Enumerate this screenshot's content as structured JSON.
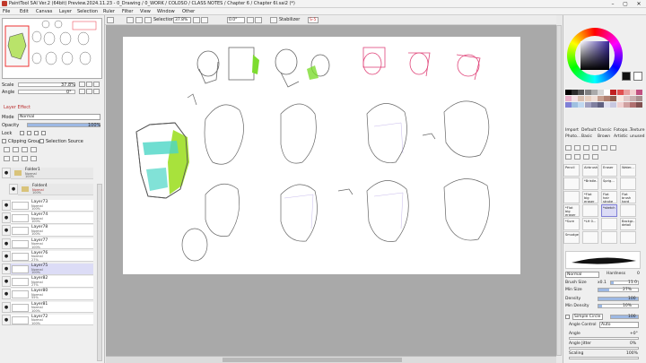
{
  "window": {
    "title": "PaintTool SAI Ver.2 (64bit) Preview.2024.11.23 - 0_Drawing / 0_WORK / COLOSO / CLASS NOTES / Chapter 6 / Chapter 6I.sai2 (*)"
  },
  "menu": [
    "File",
    "Edit",
    "Canvas",
    "Layer",
    "Selection",
    "Ruler",
    "Filter",
    "View",
    "Window",
    "Other"
  ],
  "toolbar": {
    "selection_label": "Selection",
    "zoom": "37.8%",
    "rotation": "0.0°",
    "stabilizer_label": "Stabilizer",
    "stabilizer_value": "S-5"
  },
  "nav": {
    "scale_label": "Scale",
    "scale_value": "37.8%",
    "angle_label": "Angle",
    "angle_value": "0°"
  },
  "layer_effect": {
    "title": "Layer Effect",
    "mode_label": "Mode",
    "mode_value": "Normal",
    "opacity_label": "Opacity",
    "opacity_value": "100%",
    "lock_label": "Lock",
    "clipping_label": "Clipping Group",
    "selection_source_label": "Selection Source"
  },
  "folders": [
    {
      "name": "Folder1",
      "mode": "Normal",
      "opacity": "100%"
    },
    {
      "name": "Folder4",
      "mode": "Normal",
      "opacity": "100%"
    }
  ],
  "layers": [
    {
      "name": "Layer73",
      "mode": "Normal",
      "opacity": "100%",
      "selected": false
    },
    {
      "name": "Layer74",
      "mode": "Normal",
      "opacity": "100%",
      "selected": false
    },
    {
      "name": "Layer78",
      "mode": "Normal",
      "opacity": "100%",
      "selected": false
    },
    {
      "name": "Layer77",
      "mode": "Normal",
      "opacity": "100%",
      "selected": false
    },
    {
      "name": "Layer76",
      "mode": "Normal",
      "opacity": "27%",
      "selected": false
    },
    {
      "name": "Layer75",
      "mode": "Normal",
      "opacity": "100%",
      "selected": true
    },
    {
      "name": "Layer82",
      "mode": "Normal",
      "opacity": "27%",
      "selected": false
    },
    {
      "name": "Layer80",
      "mode": "Normal",
      "opacity": "55%",
      "selected": false
    },
    {
      "name": "Layer81",
      "mode": "Normal",
      "opacity": "100%",
      "selected": false
    },
    {
      "name": "Layer72",
      "mode": "Normal",
      "opacity": "100%",
      "selected": false
    }
  ],
  "tool_tabs": [
    "Import",
    "Default",
    "Classic",
    "Fotopo...",
    "Texture",
    "Photo...",
    "Basic",
    "Brown",
    "Artistic",
    "unused"
  ],
  "brushes": [
    [
      "Pencil",
      "Airbrush",
      "Eraser",
      "Water..."
    ],
    [
      "",
      "*Bristle...",
      "Sprig...",
      ""
    ],
    [
      "",
      "*Flat big eraser",
      "Flat hair stroke",
      "Flat brush hard"
    ],
    [
      "*Flat big eraser",
      "",
      "*sketch",
      "",
      ""
    ],
    [
      "*Sure",
      "*LH 0...",
      "",
      "Backgr... detail"
    ],
    [
      "Smudge",
      "",
      "",
      ""
    ]
  ],
  "brush_props": {
    "mode_value": "Normal",
    "hardness_label": "Hardness",
    "hardness_value": "0",
    "brush_size_label": "Brush Size",
    "brush_size_mult": "x0.1",
    "brush_size_value": "11.0",
    "min_size_label": "Min Size",
    "min_size_value": "27%",
    "density_label": "Density",
    "density_value": "100",
    "min_density_label": "Min Density",
    "min_density_value": "10%",
    "circle_label": "Simple Circle",
    "circle_value": "100",
    "angle_control_label": "Angle Control",
    "angle_control_value": "Auto",
    "angle_label": "Angle",
    "angle_value": "+0°",
    "angle_jitter_label": "Angle Jitter",
    "angle_jitter_value": "0%",
    "scaling_label": "Scaling",
    "scaling_value": "100%",
    "stabilizer_fill": 0.27,
    "brush_size_fill": 0.11,
    "density_fill": 1.0,
    "min_density_fill": 0.1
  },
  "colors": {
    "current": "#111111",
    "secondary": "#ffffff",
    "accent": "#7f7fd6",
    "wheel_center": "#3a28a0"
  }
}
